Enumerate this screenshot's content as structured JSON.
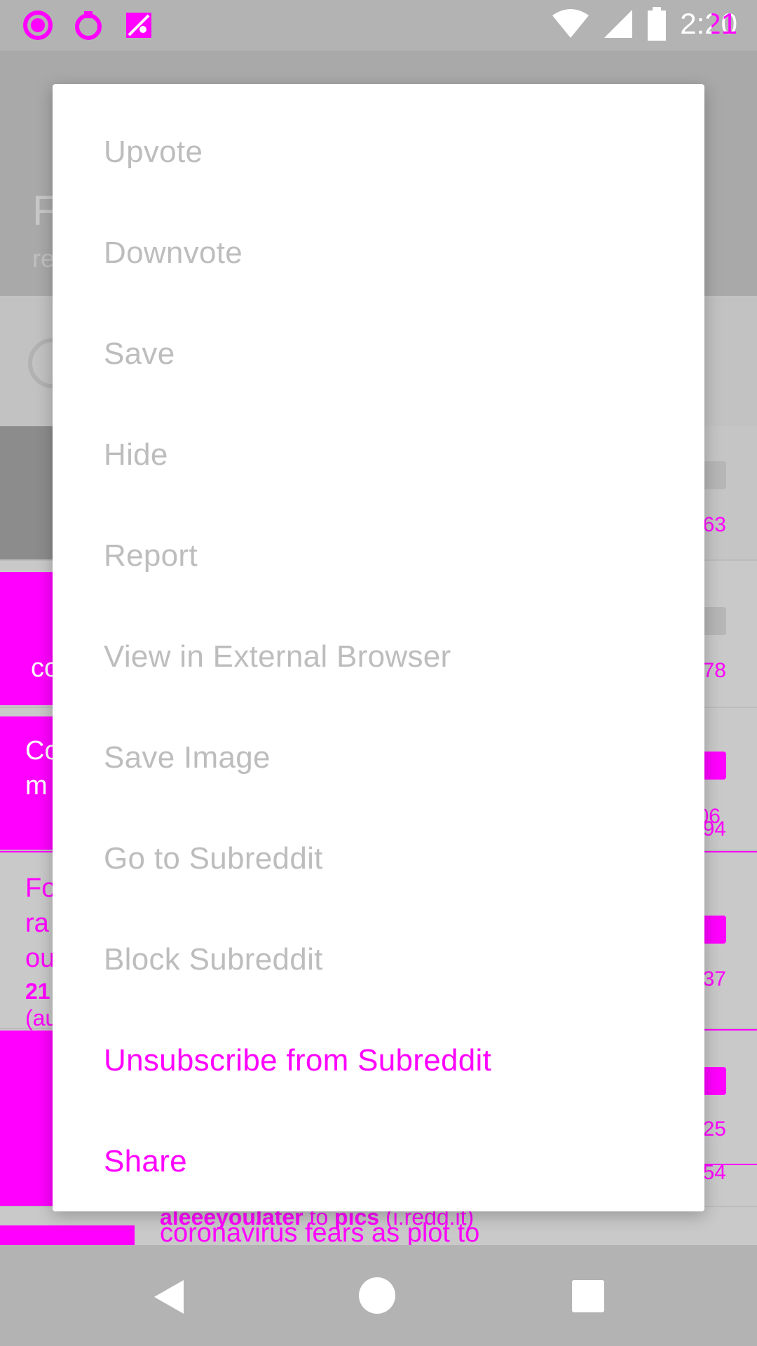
{
  "status_bar": {
    "time": "2:20",
    "time_overlay": "2:21",
    "icons": [
      "notification-circle-icon",
      "sync-icon",
      "image-icon",
      "wifi-icon",
      "signal-icon",
      "battery-icon"
    ]
  },
  "background_feed": {
    "header_title": "F",
    "header_sub": "re",
    "rows": [
      {
        "count": "63"
      },
      {
        "thumb_text": "co",
        "count": "78"
      },
      {
        "text_line1": "Co",
        "text_line2": "m",
        "count": "94",
        "count_overlay": "06"
      },
      {
        "text_line1": "Fo",
        "text_line2": "ra",
        "text_line3": "ou",
        "meta1": "21",
        "meta2": "(au",
        "count": "37"
      },
      {
        "count": "54",
        "count_overlay": "25"
      },
      {
        "meta_author": "aleeeyoulater",
        "meta_to": "to",
        "meta_sub": "pics",
        "meta_domain": "(i.redd.it)",
        "title_line": "coronavirus fears as plot to"
      }
    ]
  },
  "menu": {
    "items": [
      {
        "label": "Upvote",
        "accent": false
      },
      {
        "label": "Downvote",
        "accent": false
      },
      {
        "label": "Save",
        "accent": false
      },
      {
        "label": "Hide",
        "accent": false
      },
      {
        "label": "Report",
        "accent": false
      },
      {
        "label": "View in External Browser",
        "accent": false
      },
      {
        "label": "Save Image",
        "accent": false
      },
      {
        "label": "Go to Subreddit",
        "accent": false
      },
      {
        "label": "Block Subreddit",
        "accent": false
      },
      {
        "label": "Unsubscribe from Subreddit",
        "accent": true
      },
      {
        "label": "Share",
        "accent": true
      }
    ],
    "colors": {
      "item_text": "#bdbdbd",
      "accent": "#ff00ff"
    }
  },
  "nav_bar": {
    "buttons": [
      "back-icon",
      "home-icon",
      "recents-icon"
    ]
  }
}
